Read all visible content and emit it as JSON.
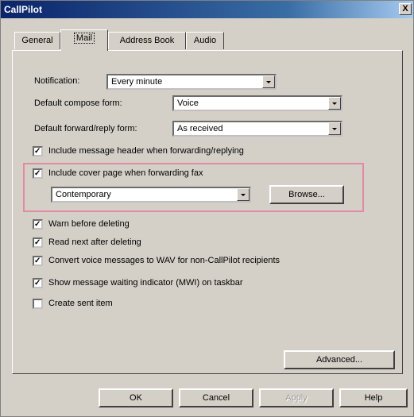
{
  "window": {
    "title": "CallPilot",
    "close_glyph": "X"
  },
  "tabs": [
    {
      "label": "General"
    },
    {
      "label": "Mail"
    },
    {
      "label": "Address Book"
    },
    {
      "label": "Audio"
    }
  ],
  "fields": {
    "notification": {
      "label": "Notification:",
      "value": "Every minute"
    },
    "compose": {
      "label": "Default compose form:",
      "value": "Voice"
    },
    "forward": {
      "label": "Default forward/reply form:",
      "value": "As received"
    }
  },
  "checkboxes": {
    "include_header": {
      "label": "Include message header when forwarding/replying",
      "checked": true
    },
    "include_cover": {
      "label": "Include cover page when forwarding fax",
      "checked": true
    },
    "warn_delete": {
      "label": "Warn before deleting",
      "checked": true
    },
    "read_next": {
      "label": "Read next after deleting",
      "checked": true
    },
    "convert_wav": {
      "label": "Convert voice messages to WAV for non-CallPilot recipients",
      "checked": true
    },
    "show_mwi": {
      "label": "Show message waiting indicator (MWI) on taskbar",
      "checked": true
    },
    "create_sent": {
      "label": "Create sent item",
      "checked": false
    }
  },
  "cover_page": {
    "value": "Contemporary",
    "browse_label": "Browse..."
  },
  "buttons": {
    "advanced": "Advanced...",
    "ok": "OK",
    "cancel": "Cancel",
    "apply": "Apply",
    "help": "Help"
  },
  "colors": {
    "highlight": "#e28aa2",
    "titlebar": "#0a246a"
  }
}
